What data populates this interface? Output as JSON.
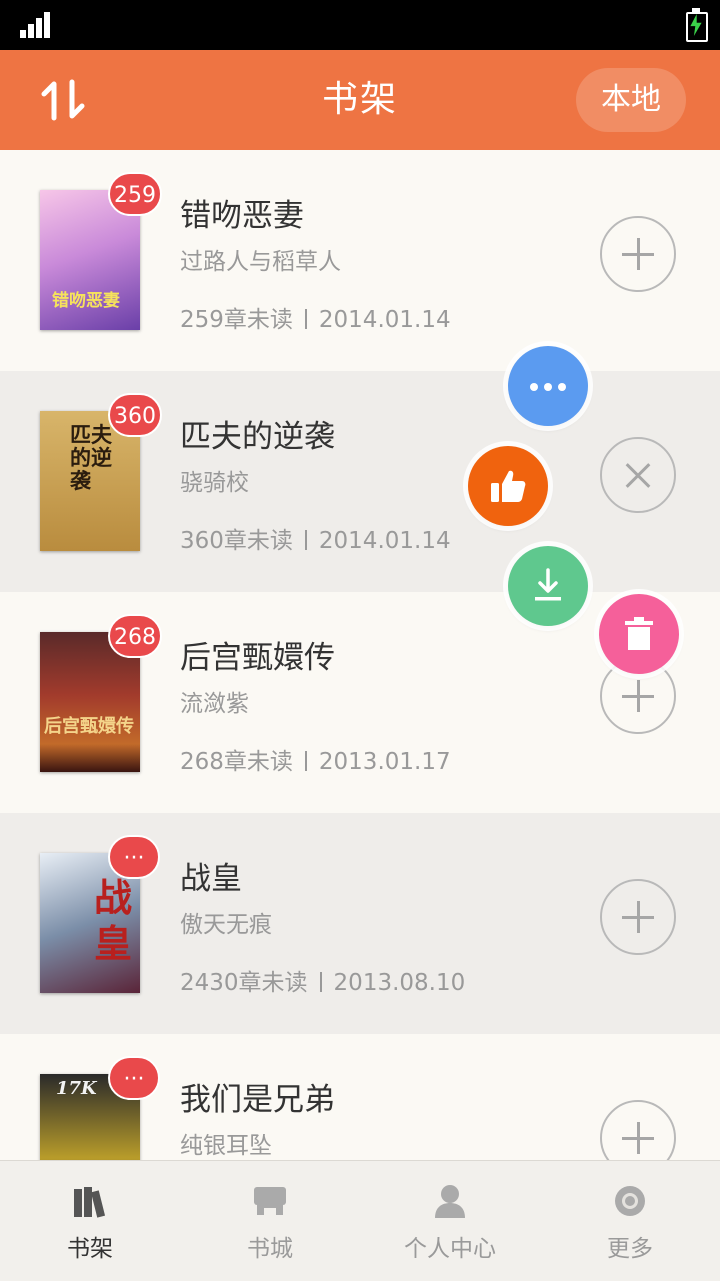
{
  "header": {
    "title": "书架",
    "local_label": "本地"
  },
  "books": [
    {
      "title": "错吻恶妻",
      "author": "过路人与稻草人",
      "unread": "259章未读",
      "date": "2014.01.14",
      "badge": "259",
      "cover_text": "错吻恶妻",
      "action": "add"
    },
    {
      "title": "匹夫的逆袭",
      "author": "骁骑校",
      "unread": "360章未读",
      "date": "2014.01.14",
      "badge": "360",
      "cover_text": "匹夫的逆袭",
      "action": "close"
    },
    {
      "title": "后宫甄嬛传",
      "author": "流潋紫",
      "unread": "268章未读",
      "date": "2013.01.17",
      "badge": "268",
      "cover_text": "后宫甄嬛传",
      "action": "add"
    },
    {
      "title": "战皇",
      "author": "傲天无痕",
      "unread": "2430章未读",
      "date": "2013.08.10",
      "badge": "···",
      "cover_text": "战皇",
      "action": "add"
    },
    {
      "title": "我们是兄弟",
      "author": "纯银耳坠",
      "unread": "",
      "date": "",
      "badge": "···",
      "cover_text": "17K",
      "action": "add"
    }
  ],
  "fab": {
    "more": "more-icon",
    "like": "thumbs-up-icon",
    "download": "download-icon",
    "delete": "trash-icon"
  },
  "nav": [
    {
      "label": "书架",
      "icon": "bookshelf-icon",
      "active": true
    },
    {
      "label": "书城",
      "icon": "bookstore-icon",
      "active": false
    },
    {
      "label": "个人中心",
      "icon": "user-icon",
      "active": false
    },
    {
      "label": "更多",
      "icon": "more-circle-icon",
      "active": false
    }
  ],
  "colors": {
    "header": "#ee7443",
    "badge": "#e9494b",
    "fab_more": "#5b9bf0",
    "fab_like": "#f0630e",
    "fab_download": "#5fc88e",
    "fab_delete": "#f5609a"
  }
}
